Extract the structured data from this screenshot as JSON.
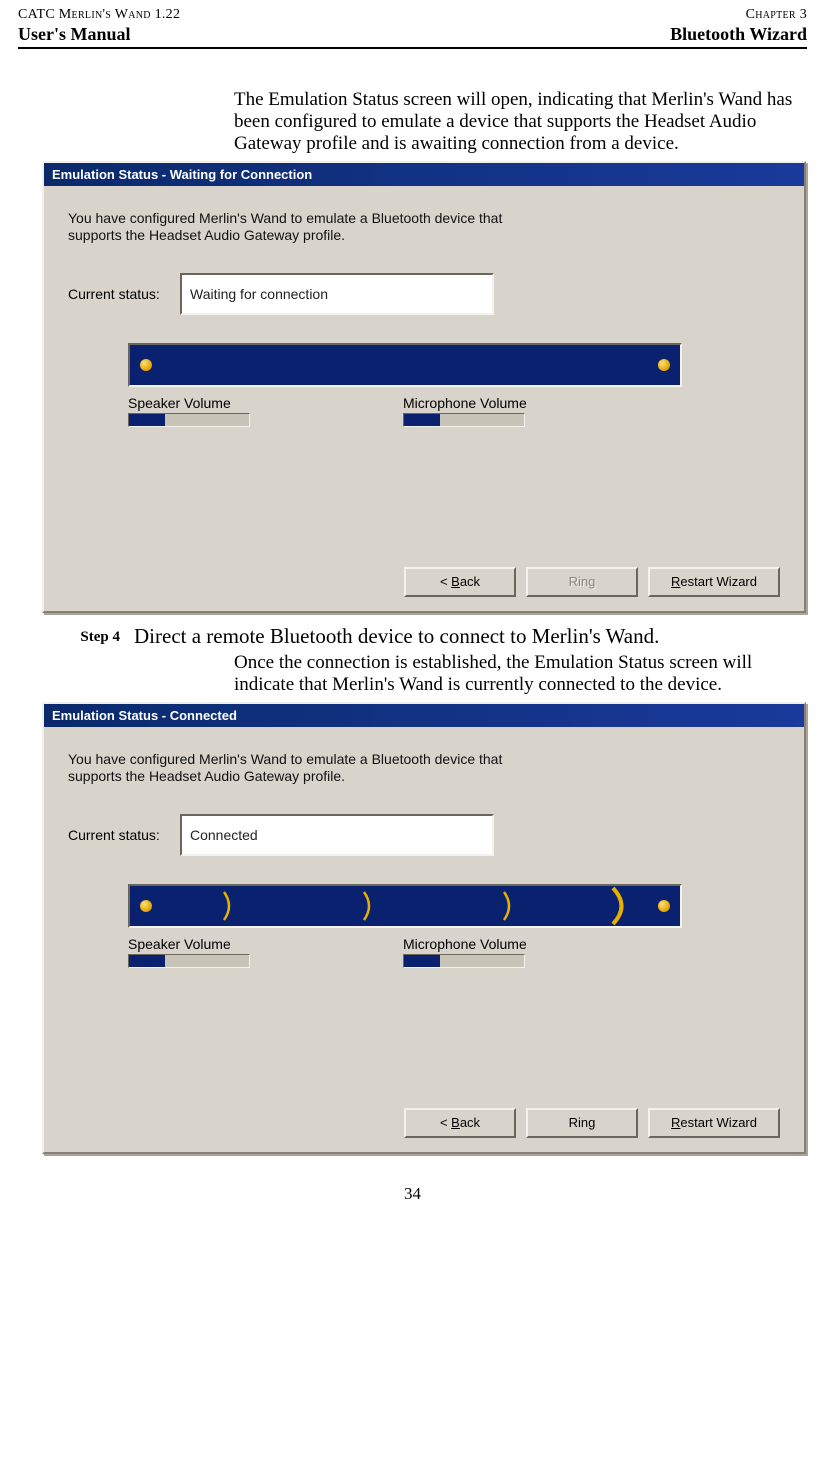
{
  "header": {
    "left_small": "CATC Merlin's Wand 1.22",
    "right_small": "Chapter 3",
    "left_bold": "User's Manual",
    "right_bold": "Bluetooth Wizard"
  },
  "intro_text": "The Emulation Status screen will open, indicating that Merlin's Wand has been configured to emulate a device that supports the Headset Audio Gateway profile and is awaiting connection from a device.",
  "dialog1": {
    "title": "Emulation Status - Waiting for Connection",
    "desc": "You have configured Merlin's Wand to emulate a Bluetooth device that supports the Headset Audio Gateway profile.",
    "status_label": "Current status:",
    "status_value": "Waiting for connection",
    "speaker_label": "Speaker Volume",
    "mic_label": "Microphone Volume",
    "btn_back": "< Back",
    "btn_ring": "Ring",
    "btn_restart": "Restart Wizard",
    "ring_enabled": false,
    "show_waves": false
  },
  "step4": {
    "label": "Step 4",
    "text": "Direct a remote Bluetooth device to connect to Merlin's Wand."
  },
  "post_step_text": "Once the connection is established, the Emulation Status screen will indicate that Merlin's Wand is currently connected to the device.",
  "dialog2": {
    "title": "Emulation Status - Connected",
    "desc": "You have configured Merlin's Wand to emulate a Bluetooth device that supports the Headset Audio Gateway profile.",
    "status_label": "Current status:",
    "status_value": "Connected",
    "speaker_label": "Speaker Volume",
    "mic_label": "Microphone Volume",
    "btn_back": "< Back",
    "btn_ring": "Ring",
    "btn_restart": "Restart Wizard",
    "ring_enabled": true,
    "show_waves": true
  },
  "page_number": "34"
}
